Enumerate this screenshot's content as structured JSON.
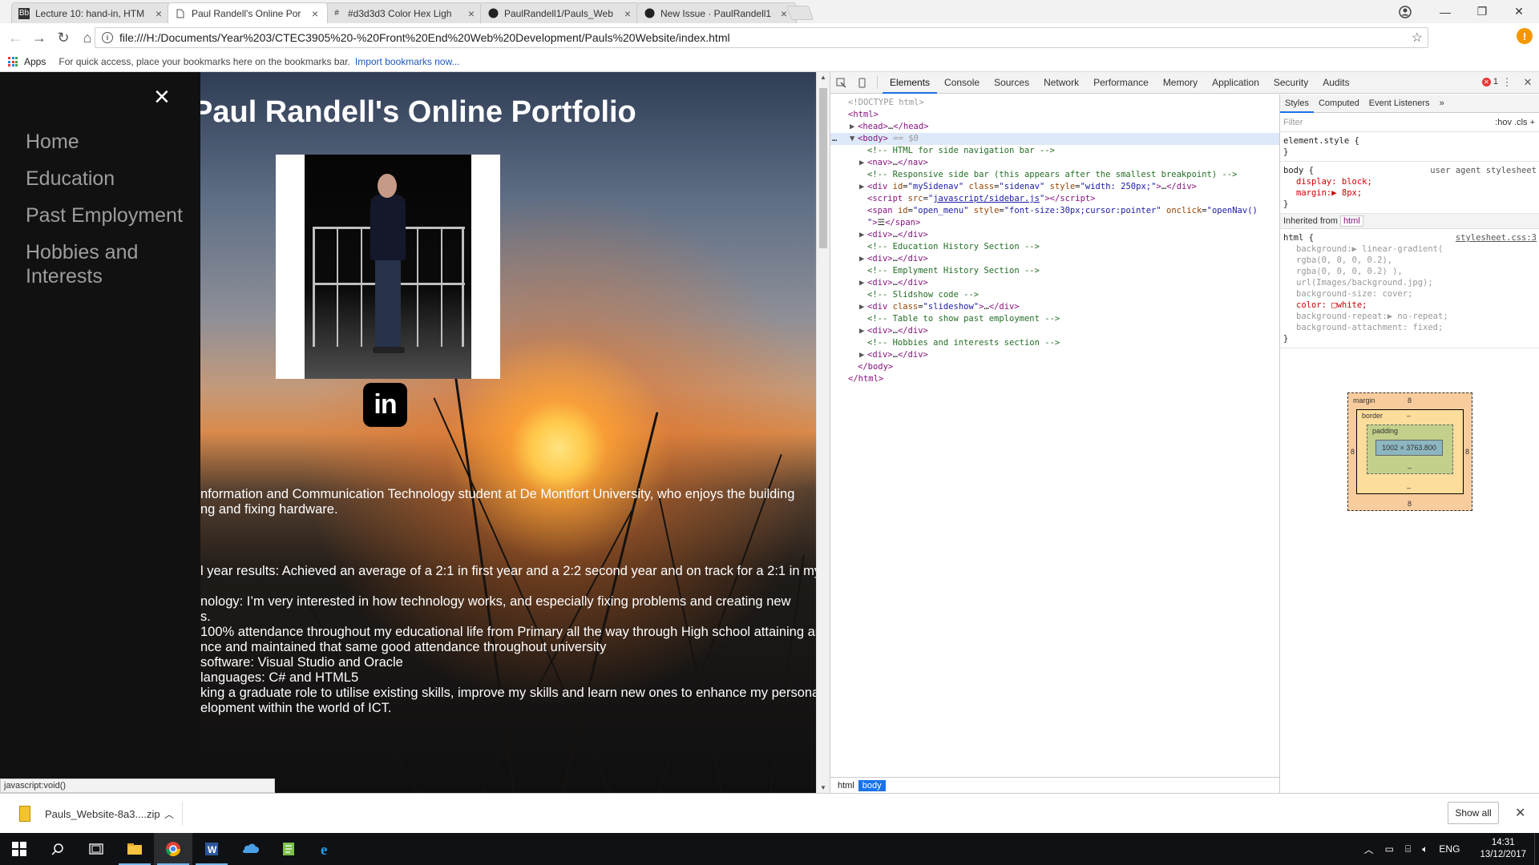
{
  "browser": {
    "tabs": [
      {
        "title": "Lecture 10: hand-in, HTM",
        "favicon": "bb",
        "active": false
      },
      {
        "title": "Paul Randell's Online Por",
        "favicon": "page",
        "active": true
      },
      {
        "title": "#d3d3d3 Color Hex Ligh",
        "favicon": "hash",
        "active": false
      },
      {
        "title": "PaulRandell1/Pauls_Web",
        "favicon": "github",
        "active": false
      },
      {
        "title": "New Issue · PaulRandell1",
        "favicon": "github",
        "active": false
      }
    ],
    "url": "file:///H:/Documents/Year%203/CTEC3905%20-%20Front%20End%20Web%20Development/Pauls%20Website/index.html",
    "bookmarks": {
      "apps_label": "Apps",
      "hint": "For quick access, place your bookmarks here on the bookmarks bar.",
      "import_link": "Import bookmarks now..."
    },
    "status_text": "javascript:void()"
  },
  "page": {
    "close_glyph": "×",
    "nav_items": [
      "Home",
      "Education",
      "Past Employment",
      "Hobbies and Interests"
    ],
    "title": "Paul Randell's Online Portfolio",
    "linkedin_glyph": "in",
    "about_lines": [
      "nformation and Communication Technology student at De Montfort University, who enjoys the building",
      "ng and fixing hardware."
    ],
    "detail_lines": [
      "l year results: Achieved an average of a 2:1 in first year and a 2:2 second year and on track for a 2:1 in my",
      "",
      "nology: I’m very interested in how technology works, and especially fixing problems and creating new",
      "s.",
      "100% attendance throughout my educational life from Primary all the way through High school attaining an",
      "nce and maintained that same good attendance throughout university",
      " software: Visual Studio and Oracle",
      "languages: C# and HTML5",
      "king a graduate role to utilise existing skills, improve my skills and learn new ones to enhance my personal",
      "elopment within the world of ICT."
    ]
  },
  "devtools": {
    "tabs": [
      "Elements",
      "Console",
      "Sources",
      "Network",
      "Performance",
      "Memory",
      "Application",
      "Security",
      "Audits"
    ],
    "active_tab": "Elements",
    "error_count": "1",
    "dom_lines": [
      {
        "indent": 0,
        "tri": "",
        "html": "<span class='dim'>&lt;!DOCTYPE html&gt;</span>"
      },
      {
        "indent": 0,
        "tri": "",
        "html": "<span class='tag'>&lt;html&gt;</span>"
      },
      {
        "indent": 1,
        "tri": "▶",
        "html": "<span class='tag'>&lt;head&gt;</span>…<span class='tag'>&lt;/head&gt;</span>"
      },
      {
        "indent": 1,
        "tri": "▼",
        "html": "<span class='tag'>&lt;body&gt;</span> <span class='dim'>== $0</span>",
        "sel": true
      },
      {
        "indent": 2,
        "tri": "",
        "html": "<span class='cmt'>&lt;!-- HTML for side navigation bar --&gt;</span>"
      },
      {
        "indent": 2,
        "tri": "▶",
        "html": "<span class='tag'>&lt;nav&gt;</span>…<span class='tag'>&lt;/nav&gt;</span>"
      },
      {
        "indent": 2,
        "tri": "",
        "html": "<span class='cmt'>&lt;!-- Responsive side bar (this appears after the smallest breakpoint) --&gt;</span>"
      },
      {
        "indent": 2,
        "tri": "▶",
        "html": "<span class='tag'>&lt;div</span> <span class='attr'>id</span>=<span class='val'>\"mySidenav\"</span> <span class='attr'>class</span>=<span class='val'>\"sidenav\"</span> <span class='attr'>style</span>=<span class='val'>\"width: 250px;\"</span><span class='tag'>&gt;</span>…<span class='tag'>&lt;/div&gt;</span>"
      },
      {
        "indent": 2,
        "tri": "",
        "html": "<span class='tag'>&lt;script</span> <span class='attr'>src</span>=<span class='val'>\"<u>javascript/sidebar.js</u>\"</span><span class='tag'>&gt;&lt;/script&gt;</span>"
      },
      {
        "indent": 2,
        "tri": "",
        "html": "<span class='tag'>&lt;span</span> <span class='attr'>id</span>=<span class='val'>\"open_menu\"</span> <span class='attr'>style</span>=<span class='val'>\"font-size:30px;cursor:pointer\"</span> <span class='attr'>onclick</span>=<span class='val'>\"openNav()</span>"
      },
      {
        "indent": 2,
        "tri": "",
        "html": "<span class='val'>\"</span><span class='tag'>&gt;</span>☰<span class='tag'>&lt;/span&gt;</span>"
      },
      {
        "indent": 2,
        "tri": "▶",
        "html": "<span class='tag'>&lt;div&gt;</span>…<span class='tag'>&lt;/div&gt;</span>"
      },
      {
        "indent": 2,
        "tri": "",
        "html": "<span class='cmt'>&lt;!-- Education History Section --&gt;</span>"
      },
      {
        "indent": 2,
        "tri": "▶",
        "html": "<span class='tag'>&lt;div&gt;</span>…<span class='tag'>&lt;/div&gt;</span>"
      },
      {
        "indent": 2,
        "tri": "",
        "html": "<span class='cmt'>&lt;!-- Emplyment History Section --&gt;</span>"
      },
      {
        "indent": 2,
        "tri": "▶",
        "html": "<span class='tag'>&lt;div&gt;</span>…<span class='tag'>&lt;/div&gt;</span>"
      },
      {
        "indent": 2,
        "tri": "",
        "html": "<span class='cmt'>&lt;!-- Slidshow code --&gt;</span>"
      },
      {
        "indent": 2,
        "tri": "▶",
        "html": "<span class='tag'>&lt;div</span> <span class='attr'>class</span>=<span class='val'>\"slideshow\"</span><span class='tag'>&gt;</span>…<span class='tag'>&lt;/div&gt;</span>"
      },
      {
        "indent": 2,
        "tri": "",
        "html": "<span class='cmt'>&lt;!-- Table to show past employment --&gt;</span>"
      },
      {
        "indent": 2,
        "tri": "▶",
        "html": "<span class='tag'>&lt;div&gt;</span>…<span class='tag'>&lt;/div&gt;</span>"
      },
      {
        "indent": 2,
        "tri": "",
        "html": "<span class='cmt'>&lt;!-- Hobbies and interests section --&gt;</span>"
      },
      {
        "indent": 2,
        "tri": "▶",
        "html": "<span class='tag'>&lt;div&gt;</span>…<span class='tag'>&lt;/div&gt;</span>"
      },
      {
        "indent": 1,
        "tri": "",
        "html": "<span class='tag'>&lt;/body&gt;</span>"
      },
      {
        "indent": 0,
        "tri": "",
        "html": "<span class='tag'>&lt;/html&gt;</span>"
      }
    ],
    "breadcrumbs": [
      "html",
      "body"
    ],
    "styles": {
      "subtabs": [
        "Styles",
        "Computed",
        "Event Listeners",
        "»"
      ],
      "filter_placeholder": "Filter",
      "filter_toggles": ":hov  .cls  +",
      "element_style": "element.style {",
      "body_rule": {
        "selector": "body {",
        "source": "user agent stylesheet",
        "props": [
          "display: block;",
          "margin:▶ 8px;"
        ]
      },
      "inherited_label": "Inherited from",
      "inherited_tag": "html",
      "html_rule": {
        "selector": "html {",
        "source": "stylesheet.css:3",
        "props": [
          {
            "text": "background:▶ linear-gradient(",
            "off": true
          },
          {
            "text": "    rgba(0, 0, 0, 0.2),",
            "off": true
          },
          {
            "text": "    rgba(0, 0, 0, 0.2) ),",
            "off": true
          },
          {
            "text": "    url(Images/background.jpg);",
            "off": true
          },
          {
            "text": "background-size: cover;",
            "off": true
          },
          {
            "text": "color: □white;",
            "off": false
          },
          {
            "text": "background-repeat:▶ no-repeat;",
            "off": true
          },
          {
            "text": "background-attachment: fixed;",
            "off": true
          }
        ]
      },
      "box_model": {
        "margin_label": "margin",
        "border_label": "border",
        "padding_label": "padding",
        "margin": "8",
        "dash": "–",
        "content_size": "1002 × 3763.800"
      }
    }
  },
  "downloads": {
    "file": "Pauls_Website-8a3....zip",
    "show_all": "Show all"
  },
  "taskbar": {
    "language": "ENG",
    "time": "14:31",
    "date": "13/12/2017"
  }
}
